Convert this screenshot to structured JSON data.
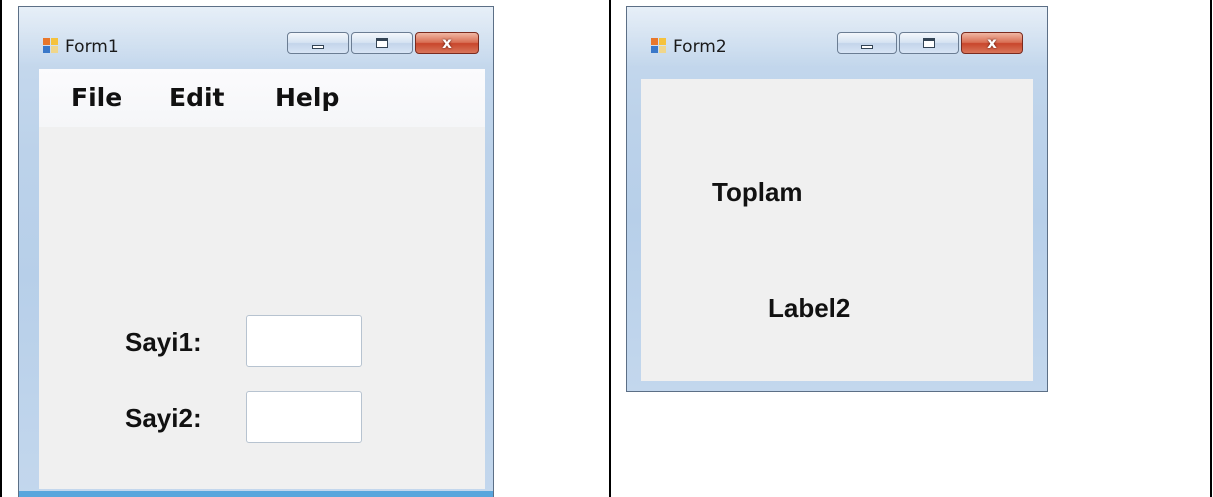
{
  "form1": {
    "title": "Form1",
    "menu": [
      "File",
      "Edit",
      "Help"
    ],
    "label1": "Sayi1:",
    "label2": "Sayi2:",
    "input1_value": "",
    "input2_value": "",
    "controls": [
      "minimize-icon",
      "maximize-icon",
      "close-icon"
    ],
    "close_glyph": "x"
  },
  "form2": {
    "title": "Form2",
    "label_toplam": "Toplam",
    "label2": "Label2",
    "controls": [
      "minimize-icon",
      "maximize-icon",
      "close-icon"
    ],
    "close_glyph": "x"
  },
  "colors": {
    "client_bg": "#f0f0f0",
    "frame": "#bcd2ea",
    "close_button": "#c8452b"
  }
}
